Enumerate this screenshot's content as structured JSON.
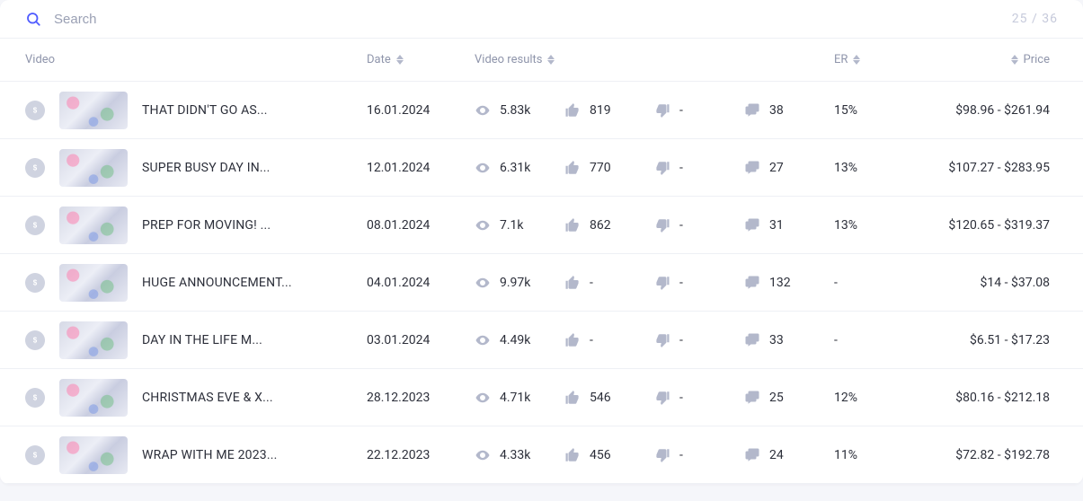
{
  "search": {
    "placeholder": "Search",
    "value": ""
  },
  "counter": "25 / 36",
  "columns": {
    "video": "Video",
    "date": "Date",
    "results": "Video results",
    "er": "ER",
    "price": "Price"
  },
  "rows": [
    {
      "title": "THAT DIDN'T GO AS...",
      "date": "16.01.2024",
      "views": "5.83k",
      "likes": "819",
      "dislikes": "-",
      "comments": "38",
      "er": "15%",
      "price": "$98.96 - $261.94"
    },
    {
      "title": "SUPER BUSY DAY IN...",
      "date": "12.01.2024",
      "views": "6.31k",
      "likes": "770",
      "dislikes": "-",
      "comments": "27",
      "er": "13%",
      "price": "$107.27 - $283.95"
    },
    {
      "title": "PREP FOR MOVING! ...",
      "date": "08.01.2024",
      "views": "7.1k",
      "likes": "862",
      "dislikes": "-",
      "comments": "31",
      "er": "13%",
      "price": "$120.65 - $319.37"
    },
    {
      "title": "HUGE ANNOUNCEMENT...",
      "date": "04.01.2024",
      "views": "9.97k",
      "likes": "-",
      "dislikes": "-",
      "comments": "132",
      "er": "-",
      "price": "$14 - $37.08"
    },
    {
      "title": "DAY IN THE LIFE M...",
      "date": "03.01.2024",
      "views": "4.49k",
      "likes": "-",
      "dislikes": "-",
      "comments": "33",
      "er": "-",
      "price": "$6.51 - $17.23"
    },
    {
      "title": "CHRISTMAS EVE & X...",
      "date": "28.12.2023",
      "views": "4.71k",
      "likes": "546",
      "dislikes": "-",
      "comments": "25",
      "er": "12%",
      "price": "$80.16 - $212.18"
    },
    {
      "title": "WRAP WITH ME 2023...",
      "date": "22.12.2023",
      "views": "4.33k",
      "likes": "456",
      "dislikes": "-",
      "comments": "24",
      "er": "11%",
      "price": "$72.82 - $192.78"
    }
  ]
}
